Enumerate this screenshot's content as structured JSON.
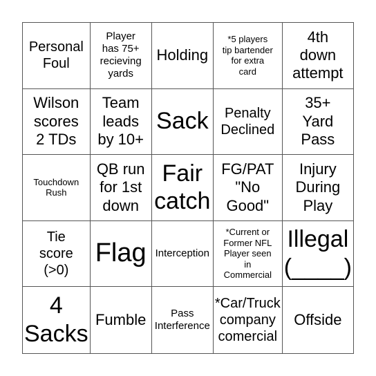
{
  "board": {
    "cells": [
      {
        "text": "Personal\nFoul",
        "size": "s-md"
      },
      {
        "text": "Player\nhas 75+\nrecieving\nyards",
        "size": "s-sm"
      },
      {
        "text": "Holding",
        "size": "s-lg"
      },
      {
        "text": "*5 players\ntip bartender\nfor extra\ncard",
        "size": "s-xs"
      },
      {
        "text": "4th\ndown\nattempt",
        "size": "s-lg"
      },
      {
        "text": "Wilson\nscores\n2 TDs",
        "size": "s-lg"
      },
      {
        "text": "Team\nleads\nby 10+",
        "size": "s-lg"
      },
      {
        "text": "Sack",
        "size": "s-xl"
      },
      {
        "text": "Penalty\nDeclined",
        "size": "s-md"
      },
      {
        "text": "35+\nYard\nPass",
        "size": "s-lg"
      },
      {
        "text": "Touchdown\nRush",
        "size": "s-xs"
      },
      {
        "text": "QB run\nfor 1st\ndown",
        "size": "s-lg"
      },
      {
        "text": "Fair\ncatch",
        "size": "s-xl"
      },
      {
        "text": "FG/PAT\n\"No\nGood\"",
        "size": "s-lg"
      },
      {
        "text": "Injury\nDuring\nPlay",
        "size": "s-lg"
      },
      {
        "text": "Tie\nscore\n(>0)",
        "size": "s-md"
      },
      {
        "text": "Flag",
        "size": "s-xxl"
      },
      {
        "text": "Interception",
        "size": "s-sm"
      },
      {
        "text": "*Current or\nFormer NFL\nPlayer seen\nin\nCommercial",
        "size": "s-xs"
      },
      {
        "text": "Illegal\n(____)",
        "size": "s-xl"
      },
      {
        "text": "4\nSacks",
        "size": "s-xl"
      },
      {
        "text": "Fumble",
        "size": "s-lg"
      },
      {
        "text": "Pass\nInterference",
        "size": "s-sm"
      },
      {
        "text": "*Car/Truck\ncompany\ncomercial",
        "size": "s-md"
      },
      {
        "text": "Offside",
        "size": "s-lg"
      }
    ]
  }
}
